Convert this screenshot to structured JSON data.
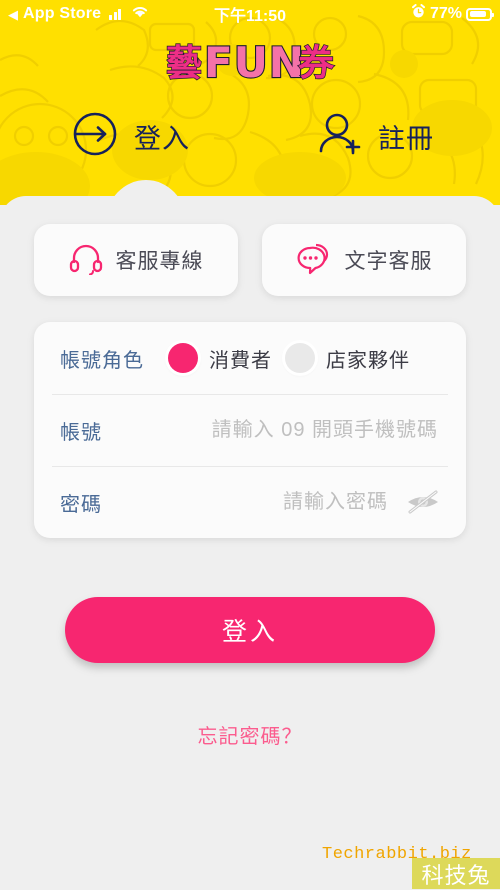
{
  "status_bar": {
    "back_label": "App Store",
    "back_icon": "triangle-left-icon",
    "signal_icon": "cellular-bars-icon",
    "wifi_icon": "wifi-icon",
    "time": "下午11:50",
    "alarm_icon": "alarm-clock-icon",
    "battery_percent": "77%",
    "battery_icon": "battery-icon"
  },
  "header": {
    "logo_text": "藝FUN券",
    "logo_part1": "藝",
    "logo_part2": "FUN",
    "logo_part3": "券",
    "background_color": "#FFE000",
    "pattern_color": "#F2D200",
    "tabs": [
      {
        "label": "登入",
        "icon": "arrow-right-circle-icon",
        "active": true
      },
      {
        "label": "註冊",
        "icon": "person-add-icon",
        "active": false
      }
    ]
  },
  "services": [
    {
      "label": "客服專線",
      "icon": "headset-icon"
    },
    {
      "label": "文字客服",
      "icon": "chat-bubbles-icon"
    }
  ],
  "form": {
    "role": {
      "label": "帳號角色",
      "options": [
        {
          "label": "消費者",
          "selected": true
        },
        {
          "label": "店家夥伴",
          "selected": false
        }
      ]
    },
    "account": {
      "label": "帳號",
      "value": "",
      "placeholder": "請輸入 09 開頭手機號碼"
    },
    "password": {
      "label": "密碼",
      "value": "",
      "placeholder": "請輸入密碼",
      "toggle_icon": "eye-slash-icon"
    }
  },
  "submit_button": {
    "label": "登入"
  },
  "forgot_link": {
    "label": "忘記密碼？"
  },
  "watermark": {
    "text": "Techrabbit.biz",
    "badge": "科技兔"
  },
  "colors": {
    "brand_pink": "#F72670",
    "brand_yellow": "#FFE000",
    "navy": "#16215B",
    "panel_gray": "#EFEFEF",
    "label_blue": "#4A6A96"
  }
}
